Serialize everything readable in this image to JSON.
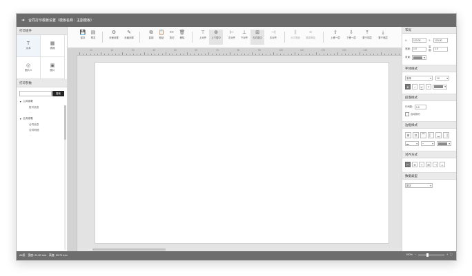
{
  "titlebar": {
    "text": "合同打印模板设置（模板名称：主副模板）"
  },
  "left": {
    "components_header": "打印组件",
    "widgets": [
      {
        "icon": "T",
        "label": "文本"
      },
      {
        "icon": "▦",
        "label": "表格"
      },
      {
        "icon": "◎",
        "label": "图片 ▾"
      },
      {
        "icon": "▣",
        "label": "图片"
      }
    ],
    "params_header": "打印参数",
    "search_button": "搜索",
    "groups": [
      {
        "label": "公共参数",
        "items": [
          "账号信息",
          "…"
        ]
      },
      {
        "label": "业务参数",
        "items": [
          "合同信息",
          "合同明细",
          "…"
        ]
      }
    ]
  },
  "toolbar": {
    "buttons": [
      {
        "icon": "💾",
        "label": "保存"
      },
      {
        "icon": "▤",
        "label": "预览"
      },
      {
        "icon": "⚙",
        "label": "页面设置"
      },
      {
        "icon": "✎",
        "label": "页眉页脚"
      },
      {
        "icon": "⧉",
        "label": "复制"
      },
      {
        "icon": "📋",
        "label": "粘贴"
      },
      {
        "icon": "✂",
        "label": "剪切"
      },
      {
        "icon": "🗑",
        "label": "删除"
      },
      {
        "icon": "⊤",
        "label": "上对齐"
      },
      {
        "icon": "⊕",
        "label": "上下居中"
      },
      {
        "icon": "⊢",
        "label": "左对齐"
      },
      {
        "icon": "⊥",
        "label": "下对齐"
      },
      {
        "icon": "⊞",
        "label": "左右居中"
      },
      {
        "icon": "⊣",
        "label": "右对齐"
      },
      {
        "icon": "⫼",
        "label": "水平等距"
      },
      {
        "icon": "≡",
        "label": "垂直等距"
      },
      {
        "icon": "⇧",
        "label": "上移一层"
      },
      {
        "icon": "⇩",
        "label": "下移一层"
      },
      {
        "icon": "⤒",
        "label": "置于顶层"
      },
      {
        "icon": "⤓",
        "label": "置于底层"
      }
    ]
  },
  "ruler": {
    "labels": [
      "10",
      "20",
      "30",
      "40",
      "50",
      "60",
      "70",
      "80",
      "90",
      "100",
      "110",
      "120",
      "130",
      "140"
    ]
  },
  "right": {
    "layout_header": "布局",
    "x_label": "X:",
    "x_value": "123.00",
    "y_label": "Y:",
    "y_value": "123.00",
    "width_label": "宽度:",
    "width_value": "1.0",
    "height_label": "高度:",
    "height_value": "1.0",
    "bg_label": "背景:",
    "font_header": "字体样式",
    "font_family": "宋体",
    "font_size": "10",
    "format_buttons": [
      "B",
      "I",
      "U",
      "T"
    ],
    "paragraph_header": "段落样式",
    "line_height_label": "行间距:",
    "line_height_value": "1.0",
    "autowrap_label": "自动换行",
    "border_header": "边框样式",
    "align_header": "对齐方式",
    "data_header": "数据类型",
    "data_type": "数字"
  },
  "status": {
    "paper": "A4纸",
    "width": "宽度: 21.00 mm",
    "height": "高度: 29.70 mm",
    "zoom": "100%"
  },
  "colors": {
    "titlebar": "#6b6b6b",
    "statusbar": "#6e6e6e",
    "canvas": "#e3e3e3",
    "accent": "#222222"
  }
}
